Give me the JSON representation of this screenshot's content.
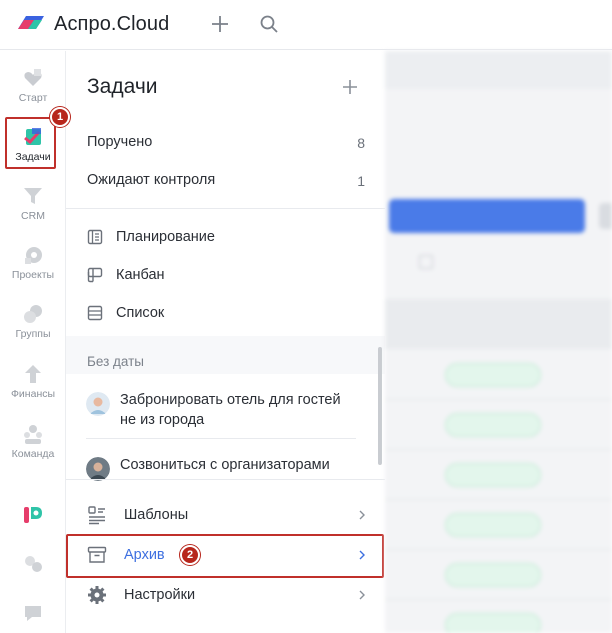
{
  "app": {
    "brand": "Аспро.Cloud"
  },
  "rail": [
    {
      "label": "Старт",
      "icon": "heart-icon"
    },
    {
      "label": "Задачи",
      "icon": "tasks-icon",
      "active": true
    },
    {
      "label": "CRM",
      "icon": "funnel-icon"
    },
    {
      "label": "Проекты",
      "icon": "projects-icon"
    },
    {
      "label": "Группы",
      "icon": "groups-icon"
    },
    {
      "label": "Финансы",
      "icon": "finance-icon"
    },
    {
      "label": "Команда",
      "icon": "team-icon"
    }
  ],
  "badges": {
    "first": "1",
    "second": "2"
  },
  "panel": {
    "title": "Задачи",
    "filters": [
      {
        "label": "Поручено",
        "count": "8"
      },
      {
        "label": "Ожидают контроля",
        "count": "1"
      }
    ],
    "views": [
      {
        "label": "Планирование",
        "icon": "planning-icon"
      },
      {
        "label": "Канбан",
        "icon": "kanban-icon"
      },
      {
        "label": "Список",
        "icon": "list-icon"
      }
    ],
    "section_label": "Без даты",
    "tasks": [
      {
        "title": "Забронировать отель для гостей не из города"
      },
      {
        "title": "Созвониться с организаторами"
      }
    ],
    "menu": [
      {
        "label": "Шаблоны",
        "icon": "templates-icon"
      },
      {
        "label": "Архив",
        "icon": "archive-icon",
        "active": true
      },
      {
        "label": "Настройки",
        "icon": "gear-icon"
      }
    ]
  },
  "colors": {
    "accent": "#3d6fe0",
    "highlight": "#c0302b",
    "badge": "#b7261c"
  }
}
